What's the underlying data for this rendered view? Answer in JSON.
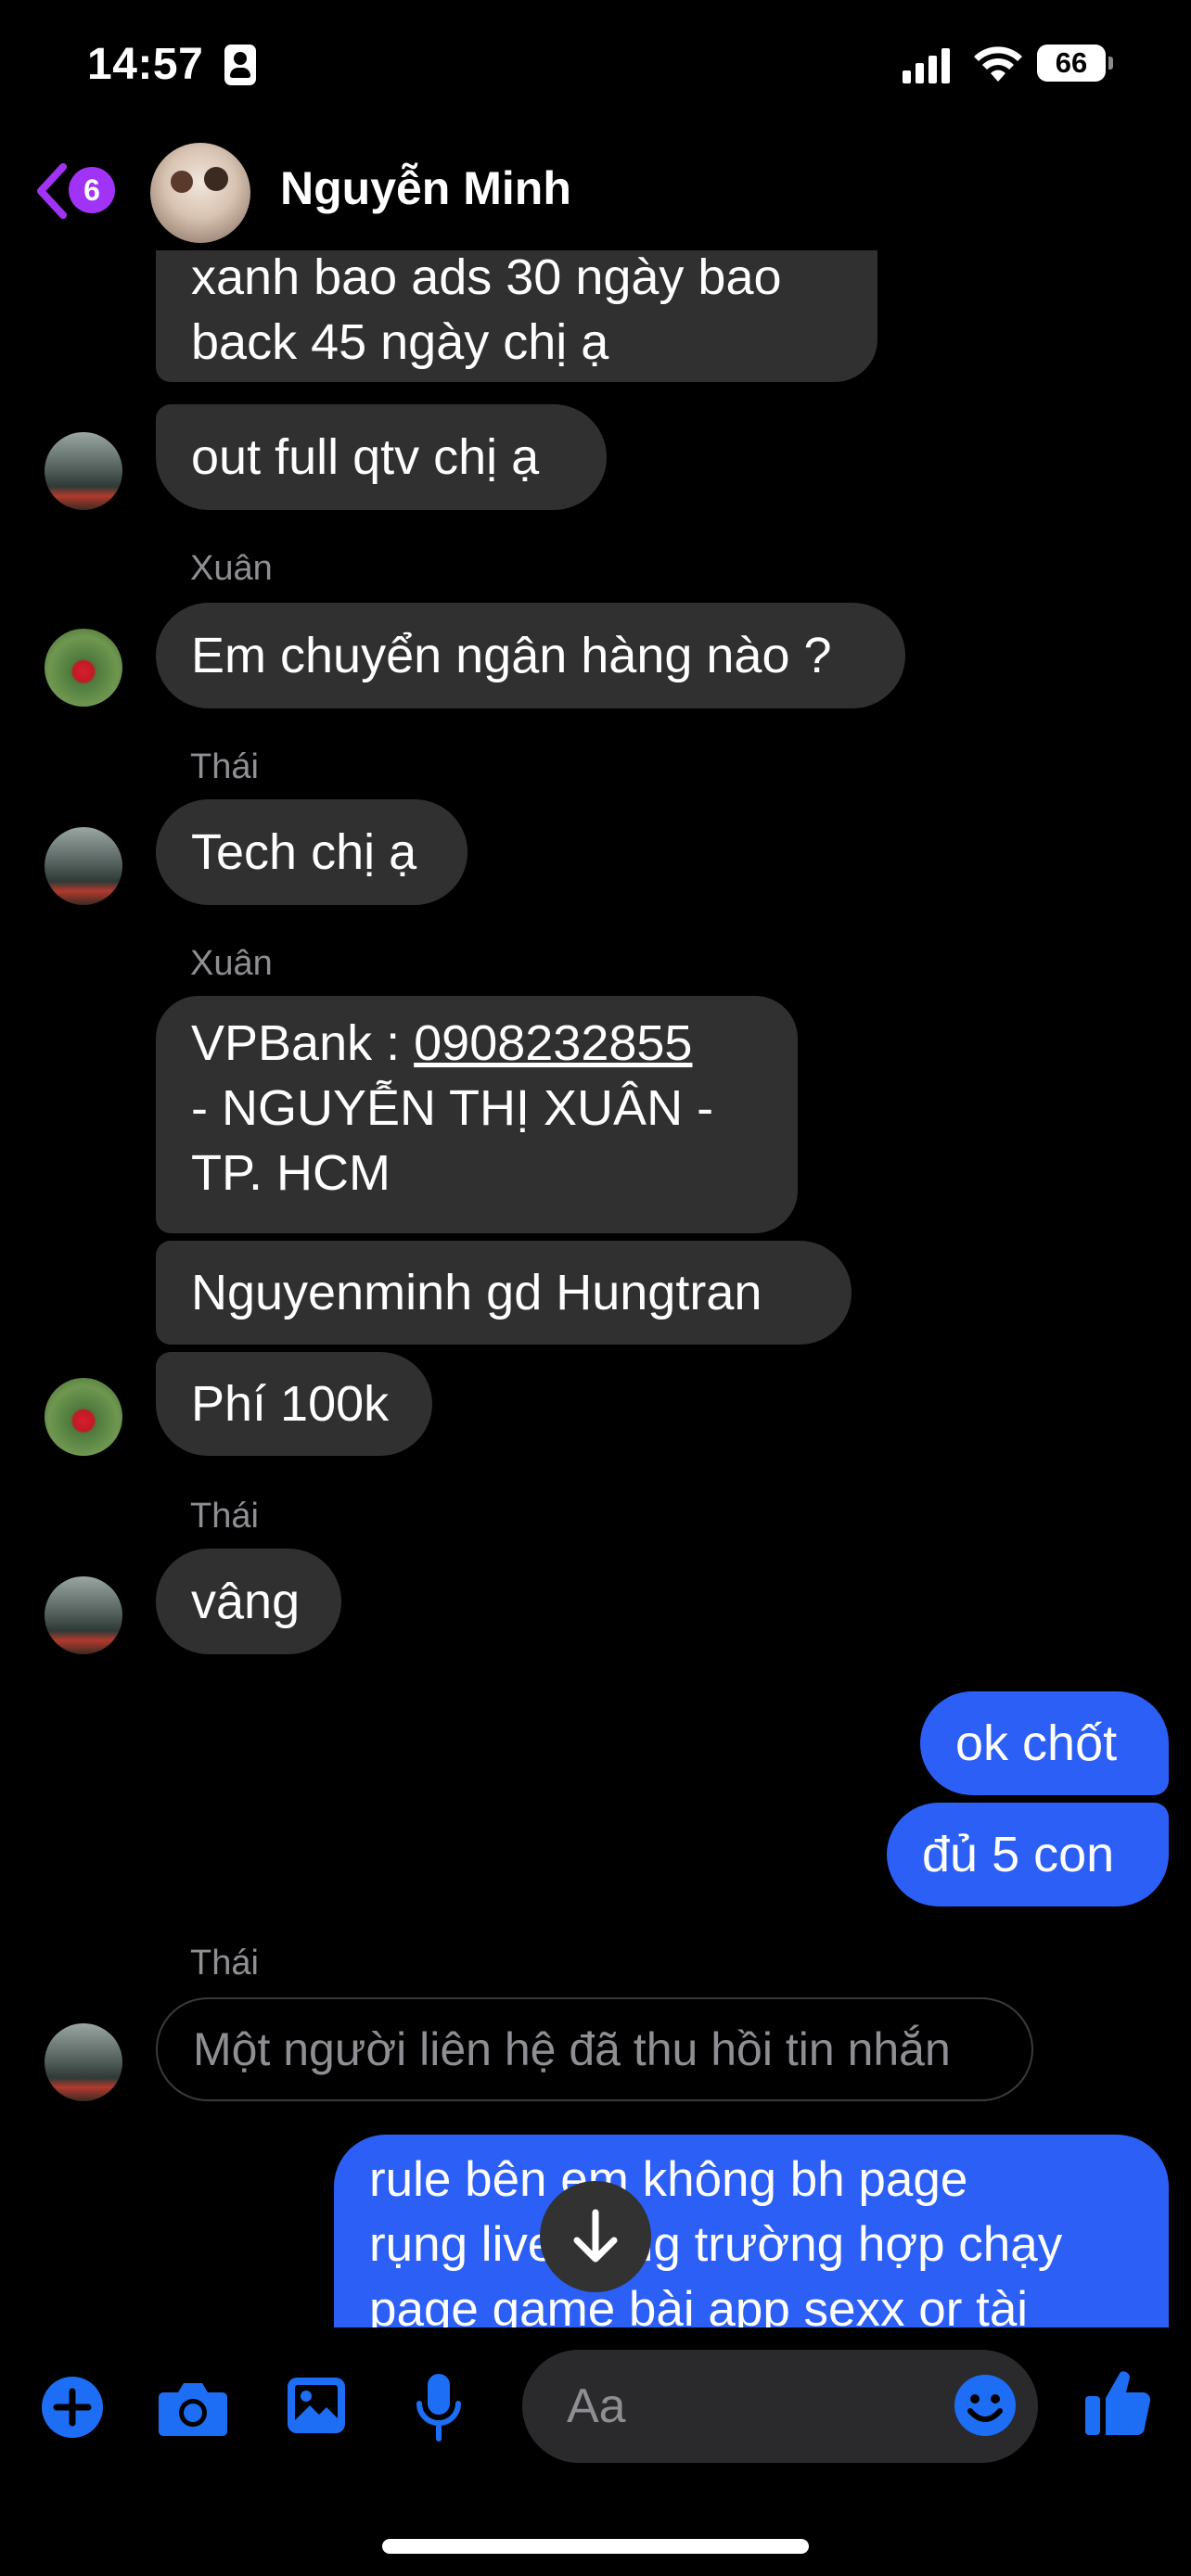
{
  "status_bar": {
    "time": "14:57",
    "battery": "66"
  },
  "header": {
    "unread_count": "6",
    "contact_name": "Nguyễn Minh"
  },
  "messages": [
    {
      "type": "in",
      "text": "xanh bao ads 30 ngày bao\nback 45 ngày chị ạ"
    },
    {
      "type": "in",
      "text": "out full qtv chị ạ"
    },
    {
      "type": "sender",
      "text": "Xuân"
    },
    {
      "type": "in",
      "text": "Em chuyển ngân hàng nào ?"
    },
    {
      "type": "sender",
      "text": "Thái"
    },
    {
      "type": "in",
      "text": "Tech chị ạ"
    },
    {
      "type": "sender",
      "text": "Xuân"
    },
    {
      "type": "in",
      "prefix": "VPBank : ",
      "link": "0908232855",
      "suffix": "\n- NGUYỄN THỊ XUÂN -\nTP. HCM"
    },
    {
      "type": "in",
      "text": "Nguyenminh gd Hungtran"
    },
    {
      "type": "in",
      "text": "Phí 100k"
    },
    {
      "type": "sender",
      "text": "Thái"
    },
    {
      "type": "in",
      "text": "vâng"
    },
    {
      "type": "out",
      "text": "ok chốt"
    },
    {
      "type": "out",
      "text": "đủ 5 con"
    },
    {
      "type": "sender",
      "text": "Thái"
    },
    {
      "type": "recalled",
      "text": "Một người liên hệ đã thu hồi tin nhắn"
    },
    {
      "type": "out",
      "text": "rule bên em không bh page\nrụng live trong trường hợp chạy\npage game bài app sexx or tài"
    }
  ],
  "composer": {
    "placeholder": "Aa"
  },
  "colors": {
    "outgoing": "#2c5ff6",
    "incoming": "#303030",
    "accent": "#1d6ef5",
    "badge": "#a033f5"
  }
}
